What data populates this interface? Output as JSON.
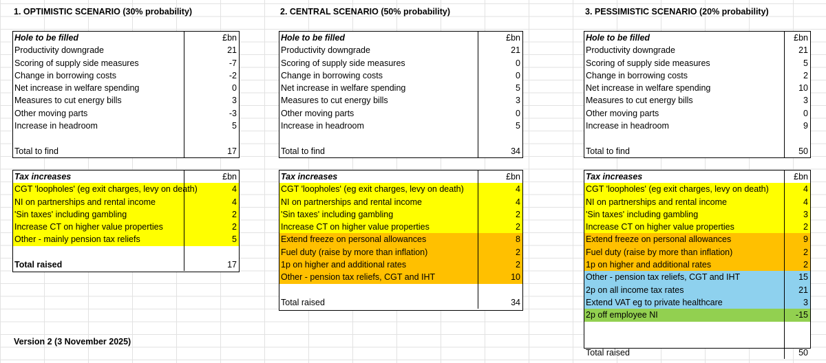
{
  "version_note": "Version 2 (3 November 2025)",
  "scenarios": [
    {
      "title": "1. OPTIMISTIC SCENARIO (30% probability)",
      "hole": {
        "header": "Hole to be filled",
        "unit": "£bn",
        "rows": [
          {
            "label": "Productivity downgrade",
            "value": "21"
          },
          {
            "label": "Scoring of supply side measures",
            "value": "-7"
          },
          {
            "label": "Change in borrowing costs",
            "value": "-2"
          },
          {
            "label": "Net increase in welfare spending",
            "value": "0"
          },
          {
            "label": "Measures to cut energy bills",
            "value": "3"
          },
          {
            "label": "Other moving parts",
            "value": "-3"
          },
          {
            "label": "Increase in headroom",
            "value": "5"
          }
        ],
        "total_label": "Total to find",
        "total_value": "17"
      },
      "tax": {
        "header": "Tax increases",
        "unit": "£bn",
        "rows": [
          {
            "label": "CGT 'loopholes' (eg exit charges, levy on death)",
            "value": "4",
            "color": "yellow"
          },
          {
            "label": "NI on partnerships and rental income",
            "value": "4",
            "color": "yellow"
          },
          {
            "label": "'Sin taxes' including gambling",
            "value": "2",
            "color": "yellow"
          },
          {
            "label": "Increase CT on higher value properties",
            "value": "2",
            "color": "yellow"
          },
          {
            "label": "Other - mainly pension tax reliefs",
            "value": "5",
            "color": "yellow"
          }
        ],
        "total_label": "Total raised",
        "total_value": "17"
      }
    },
    {
      "title": "2. CENTRAL SCENARIO (50% probability)",
      "hole": {
        "header": "Hole to be filled",
        "unit": "£bn",
        "rows": [
          {
            "label": "Productivity downgrade",
            "value": "21"
          },
          {
            "label": "Scoring of supply side measures",
            "value": "0"
          },
          {
            "label": "Change in borrowing costs",
            "value": "0"
          },
          {
            "label": "Net increase in welfare spending",
            "value": "5"
          },
          {
            "label": "Measures to cut energy bills",
            "value": "3"
          },
          {
            "label": "Other moving parts",
            "value": "0"
          },
          {
            "label": "Increase in headroom",
            "value": "5"
          }
        ],
        "total_label": "Total to find",
        "total_value": "34"
      },
      "tax": {
        "header": "Tax increases",
        "unit": "£bn",
        "rows": [
          {
            "label": "CGT 'loopholes' (eg exit charges, levy on death)",
            "value": "4",
            "color": "yellow"
          },
          {
            "label": "NI on partnerships and rental income",
            "value": "4",
            "color": "yellow"
          },
          {
            "label": "'Sin taxes' including gambling",
            "value": "2",
            "color": "yellow"
          },
          {
            "label": "Increase CT on higher value properties",
            "value": "2",
            "color": "yellow"
          },
          {
            "label": "Extend freeze on personal allowances",
            "value": "8",
            "color": "orange"
          },
          {
            "label": "Fuel duty (raise by more than inflation)",
            "value": "2",
            "color": "orange"
          },
          {
            "label": "1p on higher and additional rates",
            "value": "2",
            "color": "orange"
          },
          {
            "label": "Other - pension tax reliefs, CGT and IHT",
            "value": "10",
            "color": "orange"
          }
        ],
        "total_label": "Total raised",
        "total_value": "34"
      }
    },
    {
      "title": "3. PESSIMISTIC SCENARIO (20% probability)",
      "hole": {
        "header": "Hole to be filled",
        "unit": "£bn",
        "rows": [
          {
            "label": "Productivity downgrade",
            "value": "21"
          },
          {
            "label": "Scoring of supply side measures",
            "value": "5"
          },
          {
            "label": "Change in borrowing costs",
            "value": "2"
          },
          {
            "label": "Net increase in welfare spending",
            "value": "10"
          },
          {
            "label": "Measures to cut energy bills",
            "value": "3"
          },
          {
            "label": "Other moving parts",
            "value": "0"
          },
          {
            "label": "Increase in headroom",
            "value": "9"
          }
        ],
        "total_label": "Total to find",
        "total_value": "50"
      },
      "tax": {
        "header": "Tax increases",
        "unit": "£bn",
        "rows": [
          {
            "label": "CGT 'loopholes' (eg exit charges, levy on death)",
            "value": "4",
            "color": "yellow"
          },
          {
            "label": "NI on partnerships and rental income",
            "value": "4",
            "color": "yellow"
          },
          {
            "label": "'Sin taxes' including gambling",
            "value": "3",
            "color": "yellow"
          },
          {
            "label": "Increase CT on higher value properties",
            "value": "2",
            "color": "yellow"
          },
          {
            "label": "Extend freeze on personal allowances",
            "value": "9",
            "color": "orange"
          },
          {
            "label": "Fuel duty (raise by more than inflation)",
            "value": "2",
            "color": "orange"
          },
          {
            "label": "1p on higher and additional rates",
            "value": "2",
            "color": "orange"
          },
          {
            "label": "Other - pension tax reliefs, CGT and IHT",
            "value": "15",
            "color": "blue"
          },
          {
            "label": "2p on all income tax rates",
            "value": "21",
            "color": "blue"
          },
          {
            "label": "Extend VAT eg to private healthcare",
            "value": "3",
            "color": "blue"
          },
          {
            "label": "2p off employee NI",
            "value": "-15",
            "color": "green"
          }
        ],
        "total_label": "Total raised",
        "total_value": "50"
      }
    }
  ]
}
